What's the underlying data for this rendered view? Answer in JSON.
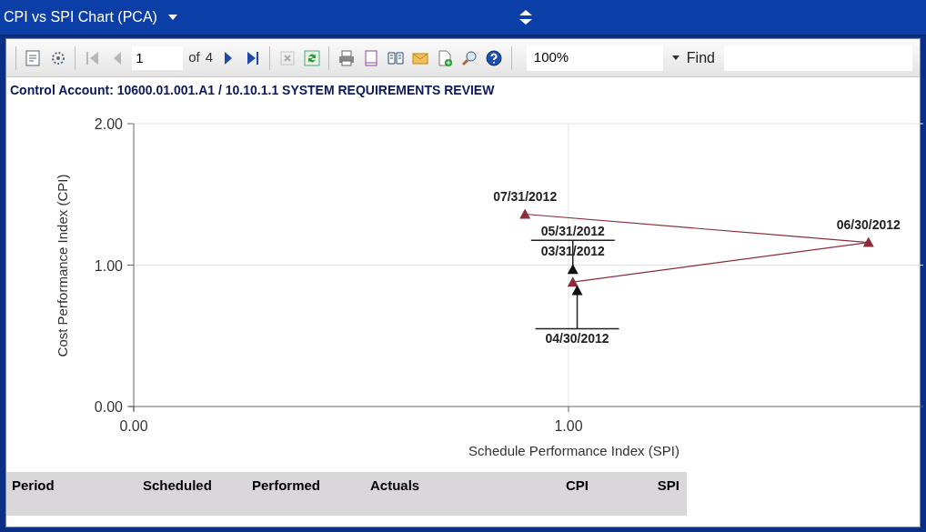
{
  "window": {
    "title": "CPI vs SPI Chart (PCA)"
  },
  "toolbar": {
    "buttons": [
      {
        "kind": "page-setup",
        "disabled": false
      },
      {
        "kind": "parameters",
        "disabled": false
      },
      {
        "kind": "first",
        "disabled": true
      },
      {
        "kind": "previous",
        "disabled": true
      },
      {
        "kind": "page"
      },
      {
        "kind": "next",
        "disabled": false
      },
      {
        "kind": "last",
        "disabled": false
      },
      {
        "kind": "stop",
        "disabled": true
      },
      {
        "kind": "refresh",
        "disabled": false
      },
      {
        "kind": "print",
        "disabled": false
      },
      {
        "kind": "layout",
        "disabled": false
      },
      {
        "kind": "book",
        "disabled": false
      },
      {
        "kind": "export",
        "disabled": false
      },
      {
        "kind": "new",
        "disabled": false
      },
      {
        "kind": "zoom-in",
        "disabled": false
      },
      {
        "kind": "help",
        "disabled": false
      }
    ],
    "page": "1",
    "of_label": "of",
    "page_count": "4",
    "zoom": "100%",
    "find_label": "Find"
  },
  "heading": "Control Account: 10600.01.001.A1 / 10.10.1.1 SYSTEM REQUIREMENTS REVIEW",
  "chart": {
    "chart_data": {
      "type": "scatter",
      "xlabel": "Schedule Performance Index (SPI)",
      "ylabel": "Cost Performance Index (CPI)",
      "xlim": [
        0,
        1.816
      ],
      "ylim": [
        0,
        2
      ],
      "xticks": [
        {
          "value": 0,
          "label": "0.00"
        },
        {
          "value": 1,
          "label": "1.00"
        }
      ],
      "yticks": [
        {
          "value": 0,
          "label": "0.00"
        },
        {
          "value": 1,
          "label": "1.00"
        },
        {
          "value": 2,
          "label": "2.00"
        }
      ],
      "series": [
        {
          "color": "#8b2d3a",
          "x": [
            1.01,
            1.69,
            0.9
          ],
          "values": [
            0.88,
            1.16,
            1.36
          ]
        },
        {
          "color": "#111111",
          "x": [
            1.01,
            1.02
          ],
          "values": [
            0.97,
            0.82
          ]
        }
      ],
      "annotations": [
        "07/31/2012",
        "06/30/2012",
        "05/31/2012",
        "03/31/2012",
        "04/30/2012"
      ]
    }
  },
  "table": {
    "columns": [
      "Period",
      "Scheduled",
      "Performed",
      "Actuals",
      "CPI",
      "SPI"
    ]
  }
}
